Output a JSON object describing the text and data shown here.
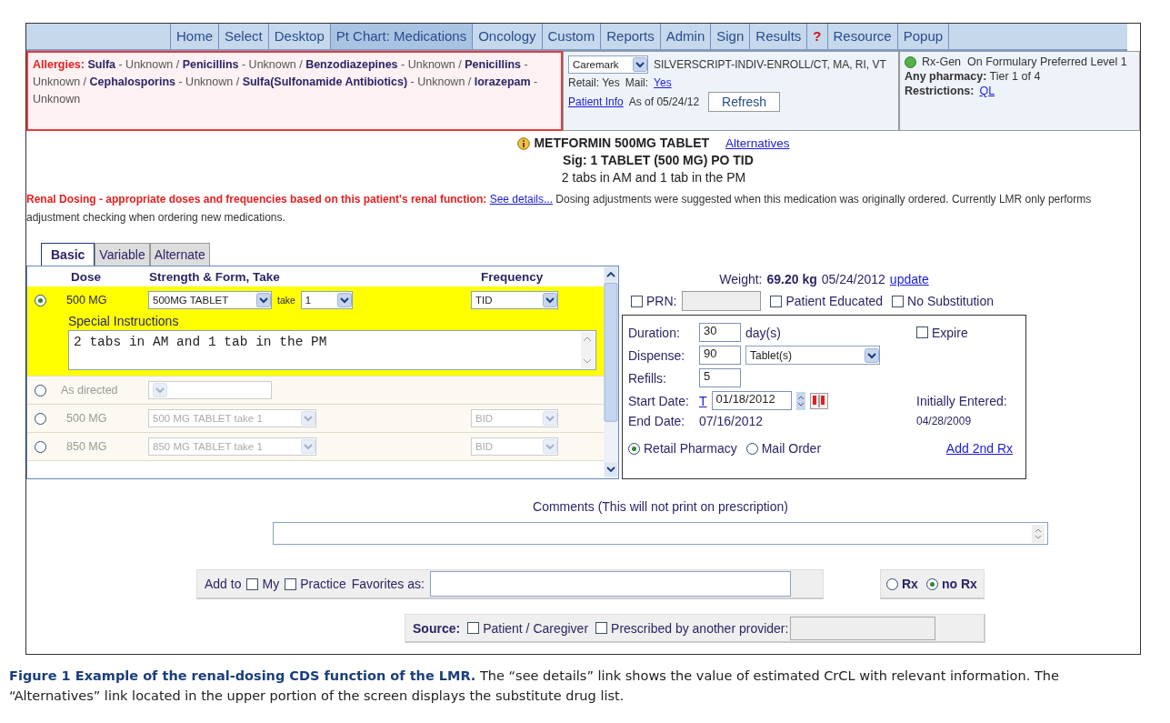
{
  "nav": [
    {
      "label": "Home",
      "kind": "page",
      "selected": false
    },
    {
      "label": "Select",
      "kind": "page",
      "selected": false
    },
    {
      "label": "Desktop",
      "kind": "page",
      "selected": false
    },
    {
      "label": "Pt Chart: Medications",
      "kind": "page",
      "selected": true
    },
    {
      "label": "Oncology",
      "kind": "page",
      "selected": false
    },
    {
      "label": "Custom",
      "kind": "page",
      "selected": false
    },
    {
      "label": "Reports",
      "kind": "page",
      "selected": false
    },
    {
      "label": "Admin",
      "kind": "page",
      "selected": false
    },
    {
      "label": "Sign",
      "kind": "page",
      "selected": false
    },
    {
      "label": "Results",
      "kind": "page",
      "selected": false
    },
    {
      "label": "?",
      "kind": "help",
      "selected": false
    },
    {
      "label": "Resource",
      "kind": "page",
      "selected": false
    },
    {
      "label": "Popup",
      "kind": "page",
      "selected": false
    }
  ],
  "allergies": {
    "label": "Allergies:",
    "text": "**Sulfa** - Unknown / **Penicillins** - Unknown / **Benzodiazepines** - Unknown / **Penicillins** - Unknown / **Cephalosporins** - Unknown / **Sulfa(Sulfonamide Antibiotics)** - Unknown / **lorazepam** - Unknown"
  },
  "insurance": {
    "carrier": "Caremark",
    "plan": "SILVERSCRIPT-INDIV-ENROLL/CT, MA, RI, VT",
    "retail": "Retail: Yes",
    "mail_label": "Mail:",
    "mail_value": "Yes",
    "patient_info": "Patient Info",
    "as_of": "As of 05/24/12",
    "refresh": "Refresh"
  },
  "formulary": {
    "status": "Rx-Gen  On Formulary Preferred Level 1",
    "pharmacy": "**Any pharmacy:** Tier 1 of 4",
    "restrictions_label": "Restrictions:",
    "restrictions_value": "QL"
  },
  "medication": {
    "name": "METFORMIN 500MG TABLET",
    "alternatives": "Alternatives",
    "sig": "Sig: 1 TABLET (500 MG) PO TID",
    "instructions": "2 tabs in AM and 1 tab in the PM"
  },
  "renal": {
    "warning": "Renal Dosing - appropriate doses and frequencies based on this patient's renal function:",
    "link": "See details...",
    "note": "Dosing adjustments were suggested when this medication was originally ordered. Currently LMR only performs adjustment checking when ordering new medications."
  },
  "dose_tabs": [
    {
      "label": "Basic",
      "selected": true
    },
    {
      "label": "Variable",
      "selected": false
    },
    {
      "label": "Alternate",
      "selected": false
    }
  ],
  "dose_table": {
    "columns": [
      "Dose",
      "Strength & Form, Take",
      "Frequency"
    ],
    "rows": [
      {
        "kind": "custom",
        "selected": true,
        "dose": "500 MG",
        "strength": "500MG TABLET",
        "take": "take",
        "quantity": "1",
        "frequency": "TID",
        "instructions_label": "Special Instructions",
        "instructions": "2 tabs in AM and 1 tab in the PM"
      },
      {
        "kind": "directed",
        "selected": false,
        "dose": "As directed"
      },
      {
        "kind": "preset",
        "selected": false,
        "dose": "500 MG",
        "strength": "500 MG TABLET take 1",
        "frequency": "BID"
      },
      {
        "kind": "preset",
        "selected": false,
        "dose": "850 MG",
        "strength": "850 MG TABLET take 1",
        "frequency": "BID"
      }
    ]
  },
  "prescription": {
    "weight_label": "Weight:",
    "weight": "69.20 kg",
    "weight_date": "05/24/2012",
    "update": "update",
    "options": [
      {
        "kind": "field",
        "label": "PRN:",
        "checked": false
      },
      {
        "kind": "plain",
        "label": "Patient Educated",
        "checked": false
      },
      {
        "kind": "plain",
        "label": "No Substitution",
        "checked": false
      }
    ],
    "duration_label": "Duration:",
    "duration": "30",
    "duration_unit": "day(s)",
    "expire": {
      "label": "Expire",
      "checked": false
    },
    "dispense_label": "Dispense:",
    "dispense": "90",
    "dispense_unit": "Tablet(s)",
    "refills_label": "Refills:",
    "refills": "5",
    "start_label": "Start Date:",
    "today_link": "T",
    "start_date": "01/18/2012",
    "initially_label": "Initially Entered:",
    "end_label": "End Date:",
    "end_date": "07/16/2012",
    "initially_date": "04/28/2009",
    "pharmacy": [
      {
        "label": "Retail Pharmacy",
        "selected": true
      },
      {
        "label": "Mail Order",
        "selected": false
      }
    ],
    "add_rx": "Add 2nd Rx"
  },
  "comments": {
    "label": "Comments (This will not print on prescription)"
  },
  "favorites": {
    "add_to": "Add to",
    "targets": [
      {
        "label": "My",
        "checked": false
      },
      {
        "label": "Practice",
        "checked": false
      }
    ],
    "favorites_as": "Favorites as:"
  },
  "rx_type": [
    {
      "label": "Rx",
      "selected": false
    },
    {
      "label": "no Rx",
      "selected": true
    }
  ],
  "source": {
    "label": "Source:",
    "options": [
      {
        "label": "Patient / Caregiver",
        "checked": false
      },
      {
        "label": "Prescribed by another provider:",
        "checked": false
      }
    ]
  },
  "caption": "**Figure 1 Example of the renal-dosing CDS function of the LMR.** The “see details” link shows the value of estimated CrCL with relevant information. The “Alternatives” link located in the upper portion of the screen displays the substitute drug list."
}
